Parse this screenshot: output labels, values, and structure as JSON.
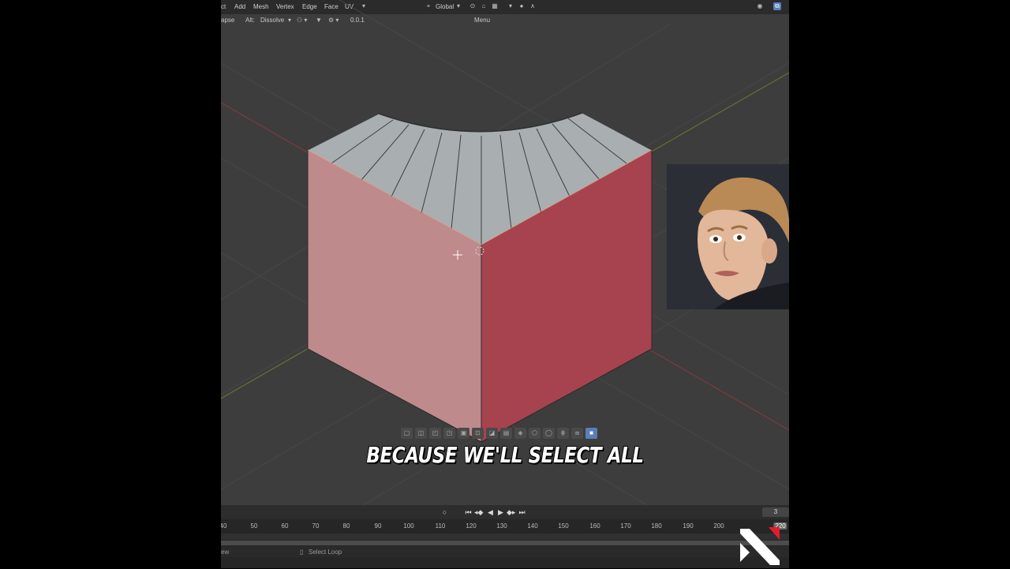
{
  "header": {
    "menu_left_cut": "ct",
    "menus": [
      "Add",
      "Mesh",
      "Vertex",
      "Edge",
      "Face",
      "UV"
    ],
    "orientation": "Global",
    "menu_hint": "Menu"
  },
  "tool_settings": {
    "mode_cut": "apse",
    "alt_label": "Alt:",
    "alt_value": "Dissolve",
    "snap_value": "0.0.1"
  },
  "caption": "BECAUSE WE'LL SELECT ALL",
  "timeline": {
    "current_frame": "3",
    "ruler": [
      "40",
      "50",
      "60",
      "70",
      "80",
      "90",
      "100",
      "110",
      "120",
      "130",
      "140",
      "150",
      "160",
      "170",
      "180",
      "190",
      "200",
      "220"
    ],
    "end_marker": "220"
  },
  "statusbar": {
    "left_cut": "ew",
    "hint": "Select Loop"
  },
  "colors": {
    "viewport_bg": "#3d3d3d",
    "top_face": "#a9afb0",
    "left_face": "#c08a8c",
    "right_face": "#a8434f",
    "selection_accent": "#5a7fb8"
  }
}
